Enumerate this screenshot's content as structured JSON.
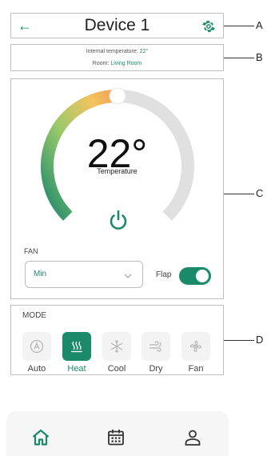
{
  "header": {
    "title": "Device 1",
    "back_icon": "arrow-left-icon",
    "settings_icon": "gear-icon"
  },
  "info": {
    "internal_temperature_label": "Internal temperature:",
    "internal_temperature_value": "22°",
    "room_label": "Room:",
    "room_value": "Living Room"
  },
  "thermostat": {
    "value_text": "22°",
    "label": "Temperature",
    "level_fraction": 0.5,
    "power_icon": "power-icon"
  },
  "fan": {
    "label": "FAN",
    "selected": "Min"
  },
  "flap": {
    "label": "Flap",
    "on": true
  },
  "mode": {
    "label": "MODE",
    "items": [
      {
        "label": "Auto",
        "icon": "auto-icon",
        "active": false
      },
      {
        "label": "Heat",
        "icon": "heat-icon",
        "active": true
      },
      {
        "label": "Cool",
        "icon": "snowflake-icon",
        "active": false
      },
      {
        "label": "Dry",
        "icon": "dry-icon",
        "active": false
      },
      {
        "label": "Fan",
        "icon": "fan-icon",
        "active": false
      }
    ]
  },
  "bottom_nav": {
    "items": [
      "home-icon",
      "calendar-icon",
      "user-icon"
    ],
    "active": "home-icon"
  },
  "callouts": {
    "a": "A",
    "b": "B",
    "c": "C",
    "d": "D"
  },
  "colors": {
    "accent": "#1b8a6b",
    "gauge_warm": "#f0a058",
    "gauge_track": "#e0e0e0"
  }
}
